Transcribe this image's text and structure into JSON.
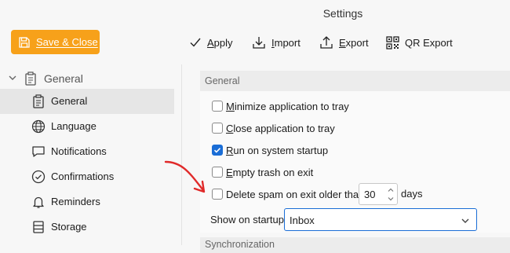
{
  "window": {
    "title": "Settings"
  },
  "toolbar": {
    "save_close": {
      "label": "Save & Close",
      "accel": "S",
      "rest": "ave & Close"
    },
    "apply": {
      "accel": "A",
      "rest": "pply"
    },
    "import": {
      "accel": "I",
      "rest": "mport"
    },
    "export": {
      "accel": "E",
      "rest": "xport"
    },
    "qr_export": {
      "label": "QR Export"
    }
  },
  "colors": {
    "accent": "#f7a11a",
    "checkbox_checked": "#1a6dd6",
    "annotation_arrow": "#e02a2a"
  },
  "sidebar": {
    "group_label": "General",
    "items": [
      {
        "label": "General",
        "icon": "clipboard-icon",
        "selected": true
      },
      {
        "label": "Language",
        "icon": "globe-icon"
      },
      {
        "label": "Notifications",
        "icon": "speech-bubble-icon"
      },
      {
        "label": "Confirmations",
        "icon": "check-circle-icon"
      },
      {
        "label": "Reminders",
        "icon": "bell-icon"
      },
      {
        "label": "Storage",
        "icon": "database-icon"
      }
    ]
  },
  "main": {
    "section_title": "General",
    "options": [
      {
        "accel": "M",
        "rest": "inimize application to tray",
        "checked": false
      },
      {
        "accel": "C",
        "rest": "lose application to tray",
        "checked": false
      },
      {
        "accel": "R",
        "rest": "un on system startup",
        "checked": true
      },
      {
        "accel": "E",
        "rest": "mpty trash on exit",
        "checked": false
      },
      {
        "accel": "",
        "rest": "Delete spam on exit older than",
        "checked": false
      }
    ],
    "spam_days": {
      "value": "30",
      "unit": "days"
    },
    "startup": {
      "label": "Show on startup:",
      "value": "Inbox"
    },
    "next_section_title": "Synchronization"
  }
}
